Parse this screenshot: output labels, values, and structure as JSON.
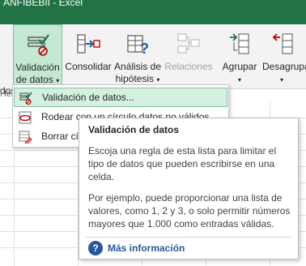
{
  "window": {
    "title_fragment": "ANFIBEBII - Excel"
  },
  "ribbon": {
    "cut_left_label": "dos",
    "cut_left_group": "Her",
    "buttons": [
      {
        "id": "validacion",
        "line1": "Validación",
        "line2": "de datos",
        "caret": "▾"
      },
      {
        "id": "consolidar",
        "line1": "Consolidar"
      },
      {
        "id": "analisis",
        "line1": "Análisis de",
        "line2": "hipótesis",
        "caret": "▾"
      },
      {
        "id": "relaciones",
        "line1": "Relaciones"
      },
      {
        "id": "agrupar",
        "line1": "Agrupar",
        "caret": "▾"
      },
      {
        "id": "desagrupar",
        "line1": "Desagrupa",
        "caret": "▾"
      }
    ]
  },
  "menu": {
    "items": [
      {
        "label": "Validación de datos...",
        "icon": "data-validation-icon",
        "highlighted": true
      },
      {
        "label": "Rodear con un círculo datos no válidos",
        "icon": "circle-invalid-icon"
      },
      {
        "label": "Borrar círculos de validación",
        "icon": "clear-circles-icon"
      }
    ]
  },
  "tooltip": {
    "title": "Validación de datos",
    "para1": "Escoja una regla de esta lista para limitar el tipo de datos que pueden escribirse en una celda.",
    "para2": "Por ejemplo, puede proporcionar una lista de valores, como 1, 2 y 3, o solo permitir números mayores que 1.000 como entradas válidas.",
    "more": "Más información",
    "more_icon": "help-icon"
  },
  "colors": {
    "accent": "#217346",
    "highlight": "#d3f0e0",
    "link": "#2b579a"
  }
}
